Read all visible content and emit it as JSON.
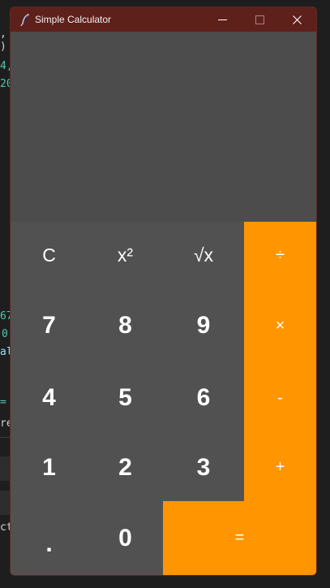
{
  "app": {
    "title": "Simple Calculator",
    "controls": {
      "minimize": "—",
      "close": "✕"
    }
  },
  "display": {
    "value": ""
  },
  "keys": {
    "clear": "C",
    "square": "x²",
    "sqrt": "√x",
    "divide": "÷",
    "multiply": "×",
    "subtract": "-",
    "add": "+",
    "equals": "=",
    "dot": ".",
    "d0": "0",
    "d1": "1",
    "d2": "2",
    "d3": "3",
    "d4": "4",
    "d5": "5",
    "d6": "6",
    "d7": "7",
    "d8": "8",
    "d9": "9"
  },
  "background_editor": {
    "fragments": [
      ",",
      ")",
      "4,",
      "20",
      "67",
      "0",
      "al",
      "=",
      "re",
      "ct"
    ]
  },
  "colors": {
    "titlebar": "#5e201b",
    "display": "#4c4c4c",
    "key_gray": "#515151",
    "key_orange": "#ff9500",
    "text": "#ffffff"
  },
  "icons": {
    "app_icon": "feather-icon"
  }
}
